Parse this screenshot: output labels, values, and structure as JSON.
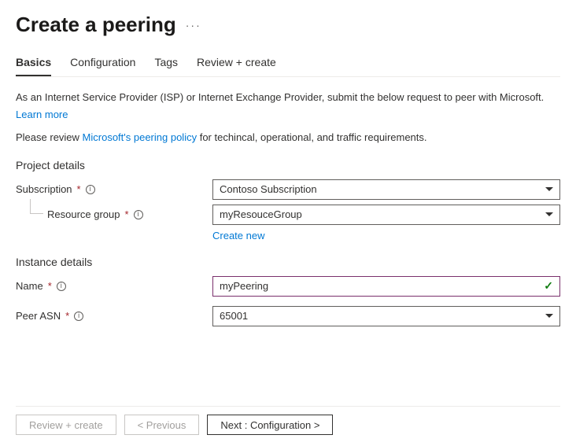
{
  "header": {
    "title": "Create a peering"
  },
  "tabs": {
    "basics": "Basics",
    "configuration": "Configuration",
    "tags": "Tags",
    "review": "Review + create"
  },
  "intro": {
    "line1": "As an Internet Service Provider (ISP) or Internet Exchange Provider, submit the below request to peer with Microsoft.",
    "learnMore": "Learn more",
    "policyPrefix": "Please review ",
    "policyLink": "Microsoft's peering policy",
    "policySuffix": " for techincal, operational, and traffic requirements."
  },
  "sections": {
    "projectDetails": "Project details",
    "instanceDetails": "Instance details"
  },
  "fields": {
    "subscription": {
      "label": "Subscription",
      "value": "Contoso Subscription"
    },
    "resourceGroup": {
      "label": "Resource group",
      "value": "myResouceGroup",
      "createNew": "Create new"
    },
    "name": {
      "label": "Name",
      "value": "myPeering"
    },
    "peerAsn": {
      "label": "Peer ASN",
      "value": "65001"
    }
  },
  "buttons": {
    "reviewCreate": "Review + create",
    "previous": "< Previous",
    "next": "Next : Configuration >"
  }
}
